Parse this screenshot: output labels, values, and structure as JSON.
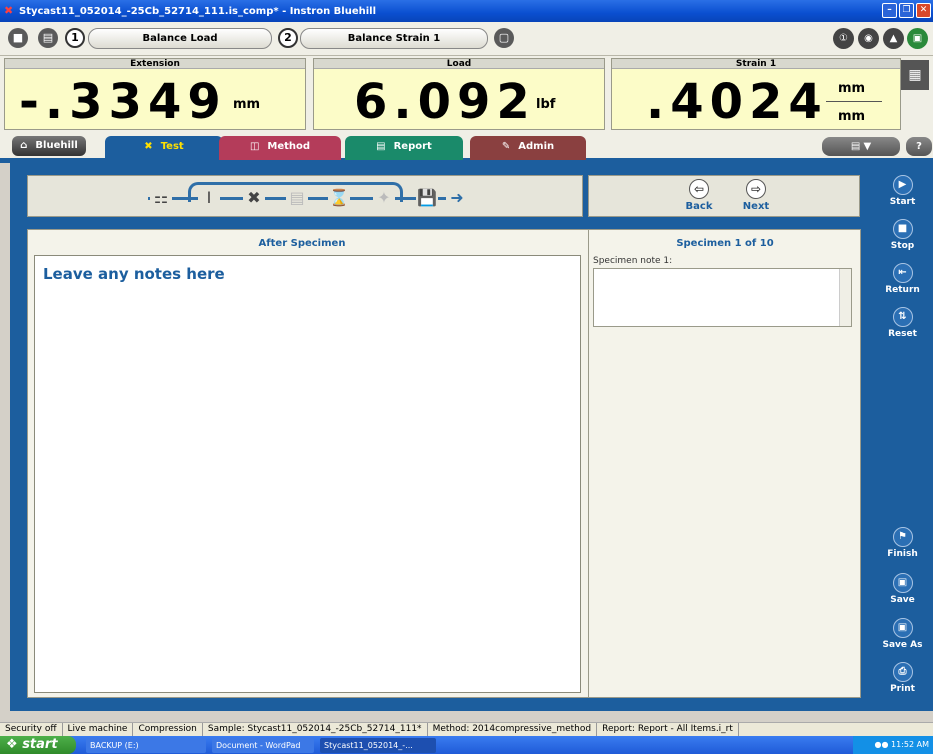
{
  "window": {
    "title": "Stycast11_052014_-25Cb_52714_111.is_comp* - Instron Bluehill"
  },
  "balance": {
    "num1": "1",
    "button1": "Balance Load",
    "num2": "2",
    "button2": "Balance Strain 1"
  },
  "readouts": [
    {
      "label": "Extension",
      "value": "-.3349",
      "unit": "mm"
    },
    {
      "label": "Load",
      "value": "6.092",
      "unit": "lbf"
    },
    {
      "label": "Strain 1",
      "value": ".4024",
      "unit_top": "mm",
      "unit_bottom": "mm"
    }
  ],
  "tabs": {
    "bluehill": "Bluehill",
    "test": "Test",
    "method": "Method",
    "report": "Report",
    "admin": "Admin",
    "help": "?"
  },
  "nav": {
    "back": "Back",
    "next": "Next"
  },
  "content": {
    "title": "After Specimen",
    "notes_placeholder": "Leave any notes here",
    "specimen_count": "Specimen 1 of 10",
    "specimen_note_label": "Specimen note 1:"
  },
  "actions": {
    "start": "Start",
    "stop": "Stop",
    "return": "Return",
    "reset": "Reset",
    "finish": "Finish",
    "save": "Save",
    "save_as": "Save As",
    "print": "Print"
  },
  "status": [
    "Security off",
    "Live machine",
    "Compression",
    "Sample: Stycast11_052014_-25Cb_52714_111*",
    "Method: 2014compressive_method",
    "Report: Report - All Items.i_rt"
  ],
  "taskbar": {
    "start": "start",
    "tasks": [
      "BACKUP (E:)",
      "Document - WordPad",
      "Stycast11_052014_-..."
    ],
    "clock": "11:52 AM"
  },
  "colors": {
    "accent": "#1c5e9e",
    "readout_bg": "#fcfcc8",
    "tab_test": "#1c5e9e",
    "tab_method": "#b43c5a",
    "tab_report": "#1a8a6a",
    "tab_admin": "#8a4040"
  }
}
